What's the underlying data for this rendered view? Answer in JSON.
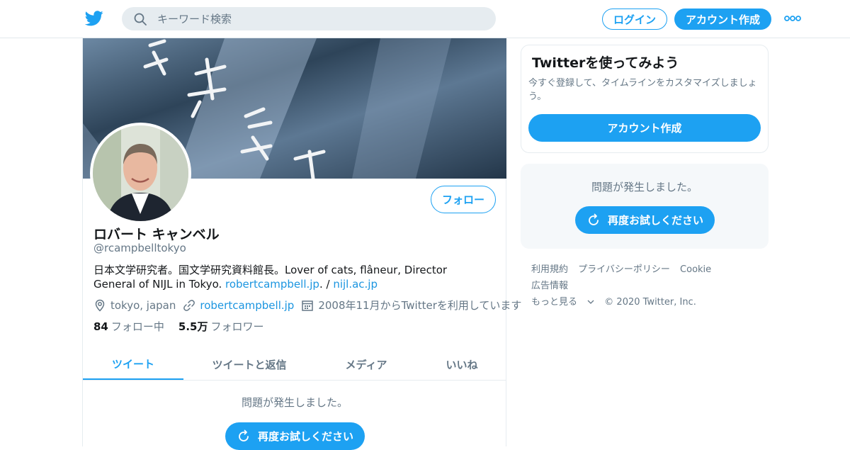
{
  "header": {
    "search_placeholder": "キーワード検索",
    "login_label": "ログイン",
    "signup_label": "アカウント作成"
  },
  "profile": {
    "name": "ロバート キャンベル",
    "handle": "@rcampbelltokyo",
    "bio_text": "日本文学研究者。国文学研究資料館長。Lover of cats, flâneur, Director General of NIJL in Tokyo. ",
    "bio_link1": "robertcampbell.jp",
    "bio_sep": ". / ",
    "bio_link2": "nijl.ac.jp",
    "location": "tokyo, japan",
    "website": "robertcampbell.jp",
    "joined": "2008年11月からTwitterを利用しています",
    "following_count": "84",
    "following_label": "フォロー中",
    "followers_count": "5.5万",
    "followers_label": "フォロワー",
    "follow_label": "フォロー"
  },
  "tabs": [
    "ツイート",
    "ツイートと返信",
    "メディア",
    "いいね"
  ],
  "timeline": {
    "error": "問題が発生しました。",
    "retry": "再度お試しください"
  },
  "sidebar": {
    "card_title": "Twitterを使ってみよう",
    "card_desc": "今すぐ登録して、タイムラインをカスタマイズしましょう。",
    "card_button": "アカウント作成",
    "error": "問題が発生しました。",
    "retry": "再度お試しください"
  },
  "footer": {
    "links": [
      "利用規約",
      "プライバシーポリシー",
      "Cookie",
      "広告情報",
      "もっと見る"
    ],
    "copyright": "© 2020 Twitter, Inc."
  },
  "colors": {
    "accent": "#1da1f2",
    "muted": "#657786"
  }
}
